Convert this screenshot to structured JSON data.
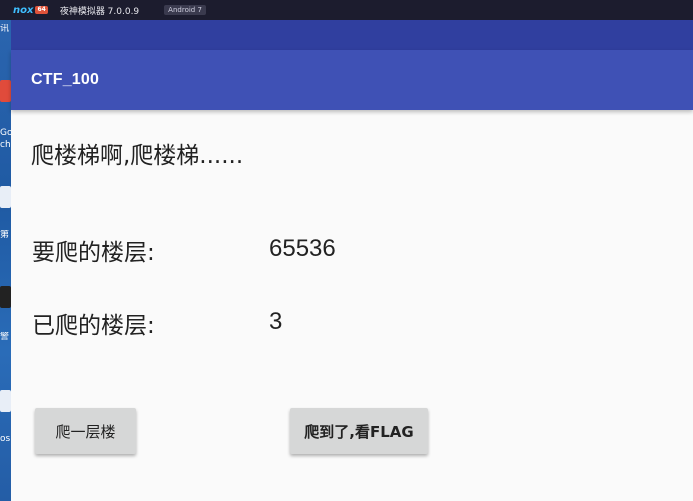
{
  "emulator": {
    "logo_text": "nox",
    "logo_tag": "64",
    "title": "夜神模拟器 7.0.0.9",
    "android_badge": "Android 7"
  },
  "desktop": {
    "labels": [
      "讯",
      "Go",
      "ch",
      "第",
      "警",
      "os"
    ]
  },
  "app": {
    "title": "CTF_100",
    "headline": "爬楼梯啊,爬楼梯......",
    "target_floor_label": "要爬的楼层:",
    "target_floor_value": "65536",
    "climbed_floor_label": "已爬的楼层:",
    "climbed_floor_value": "3",
    "climb_button": "爬一层楼",
    "flag_button": "爬到了,看FLAG"
  },
  "colors": {
    "status_bar": "#303f9f",
    "app_bar": "#3f51b5",
    "button_bg": "#d6d7d7",
    "background": "#fafafa"
  }
}
